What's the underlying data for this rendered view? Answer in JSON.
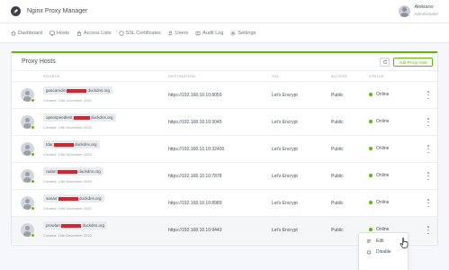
{
  "app": {
    "title": "Nginx Proxy Manager"
  },
  "user": {
    "name": "Alekiano",
    "role": "Administrator"
  },
  "nav": [
    {
      "label": "Dashboard",
      "icon": "home-icon"
    },
    {
      "label": "Hosts",
      "icon": "monitor-icon"
    },
    {
      "label": "Access Lists",
      "icon": "lock-icon"
    },
    {
      "label": "SSL Certificates",
      "icon": "shield-icon"
    },
    {
      "label": "Users",
      "icon": "users-icon"
    },
    {
      "label": "Audit Log",
      "icon": "book-icon"
    },
    {
      "label": "Settings",
      "icon": "gear-icon"
    }
  ],
  "card": {
    "title": "Proxy Hosts",
    "add_label": "Add Proxy Host"
  },
  "columns": {
    "source": "SOURCE",
    "destination": "DESTINATION",
    "ssl": "SSL",
    "access": "ACCESS",
    "status": "STATUS"
  },
  "rows": [
    {
      "domain_prefix": "guacamole.",
      "domain_suffix": ".duckdns.org",
      "created": "Created: 13th December 2020",
      "destination": "https://192.168.10.10:8050",
      "ssl": "Let's Encrypt",
      "access": "Public",
      "status": "Online"
    },
    {
      "domain_prefix": "openspeedtest.",
      "domain_suffix": ".duckdns.org",
      "created": "Created: 13th December 2020",
      "destination": "https://192.168.10.10:3045",
      "ssl": "Let's Encrypt",
      "access": "Public",
      "status": "Online"
    },
    {
      "domain_prefix": "tdar.",
      "domain_suffix": ".duckdns.org",
      "created": "Created: 13th December 2020",
      "destination": "https://192.168.10.10:32400",
      "ssl": "Let's Encrypt",
      "access": "Public",
      "status": "Online"
    },
    {
      "domain_prefix": "radarr.",
      "domain_suffix": ".duckdns.org",
      "created": "Created: 13th December 2020",
      "destination": "https://192.168.10.10:7878",
      "ssl": "Let's Encrypt",
      "access": "Public",
      "status": "Online"
    },
    {
      "domain_prefix": "sonarr.",
      "domain_suffix": ".duckdns.org",
      "created": "Created: 13th December 2020",
      "destination": "https://192.168.10.10:8989",
      "ssl": "Let's Encrypt",
      "access": "Public",
      "status": "Online"
    },
    {
      "domain_prefix": "prowlarr.",
      "domain_suffix": ".duckdns.org",
      "created": "Created: 13th December 2020",
      "destination": "https://192.168.10.10:9443",
      "ssl": "Let's Encrypt",
      "access": "Public",
      "status": "Online"
    }
  ],
  "dropdown": {
    "edit": "Edit",
    "disable": "Disable"
  },
  "colors": {
    "accent": "#5eba00",
    "redaction": "#d9232e"
  }
}
